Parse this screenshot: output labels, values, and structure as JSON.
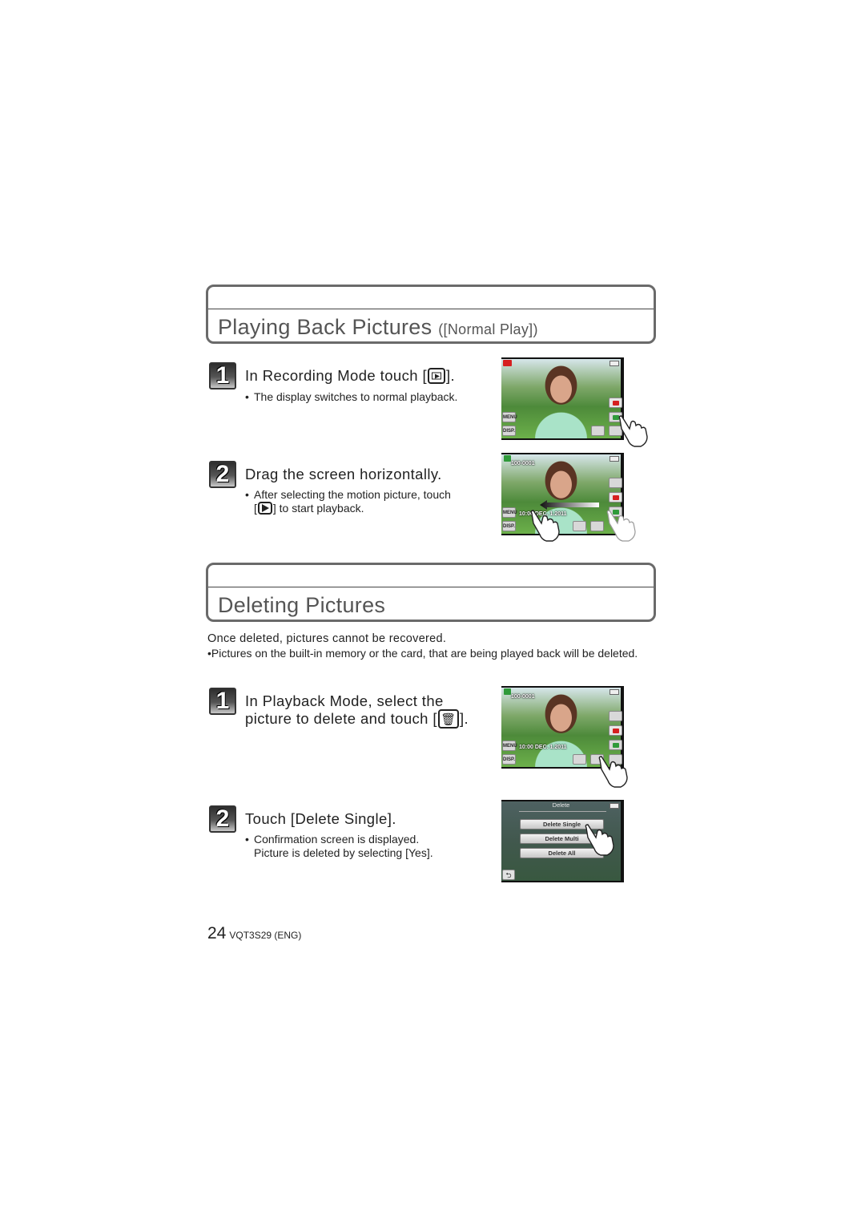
{
  "section_playback": {
    "title": "Playing Back Pictures",
    "subtitle": "([Normal Play])",
    "steps": [
      {
        "number": "1",
        "title_before": "In Recording Mode touch [",
        "title_icon": "playback-button-icon",
        "title_after": "].",
        "notes": [
          "The display switches to normal playback."
        ],
        "screen": {
          "left_buttons": [
            "MENU",
            "DISP."
          ],
          "hand_target": "playback-button"
        }
      },
      {
        "number": "2",
        "title": "Drag the screen horizontally.",
        "note_before": "After selecting the motion picture, touch",
        "note_icon": "play-icon",
        "note_after": "] to start playback.",
        "note_bracket_open": "[",
        "screen": {
          "file_number": "100-0001",
          "date_readout": "10:00 DEC. 1.2011",
          "left_buttons": [
            "MENU",
            "DISP."
          ],
          "gesture": "drag-left"
        }
      }
    ]
  },
  "section_delete": {
    "title": "Deleting Pictures",
    "intro": "Once deleted, pictures cannot be recovered.",
    "intro_bullet": "Pictures on the built-in memory or the card, that are being played back will be deleted.",
    "steps": [
      {
        "number": "1",
        "title_line1": "In Playback Mode, select the",
        "title_line2_before": "picture to delete and touch [",
        "title_icon": "trash-icon",
        "title_after": "].",
        "screen": {
          "file_number": "100-0001",
          "date_readout": "10:00 DEC. 1.2011",
          "left_buttons": [
            "MENU",
            "DISP."
          ],
          "hand_target": "delete-button"
        }
      },
      {
        "number": "2",
        "title": "Touch [Delete Single].",
        "notes": [
          "Confirmation screen is displayed.",
          "Picture is deleted by selecting [Yes]."
        ],
        "screen": {
          "menu_title": "Delete",
          "options": [
            "Delete Single",
            "Delete Multi",
            "Delete All"
          ],
          "back_glyph": "⮌"
        }
      }
    ]
  },
  "footer": {
    "page_number": "24",
    "doc_code": "VQT3S29 (ENG)"
  },
  "colors": {
    "section_border": "#6a6a6a",
    "title_text": "#555555",
    "body_text": "#222222",
    "record_red": "#d62020",
    "playback_green": "#2f9a3a"
  }
}
